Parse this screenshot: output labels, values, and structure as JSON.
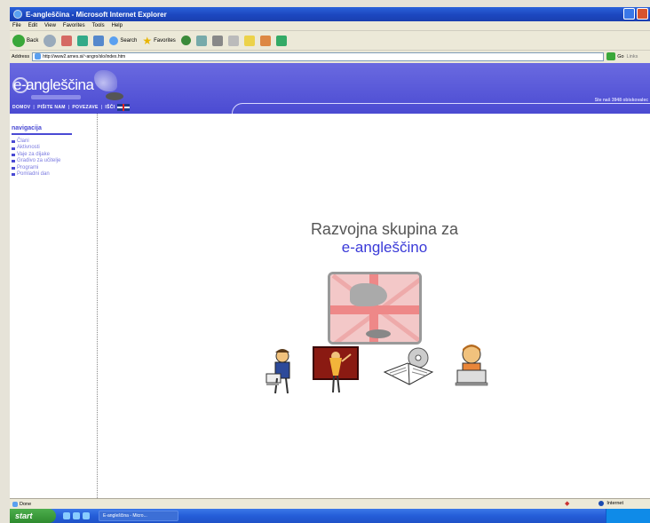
{
  "window": {
    "title": "E-angleščina - Microsoft Internet Explorer"
  },
  "menubar": [
    "File",
    "Edit",
    "View",
    "Favorites",
    "Tools",
    "Help"
  ],
  "toolbar": {
    "back_label": "Back",
    "search_label": "Search",
    "favorites_label": "Favorites"
  },
  "addressbar": {
    "label": "Address",
    "url": "http://www2.arnes.si/~angro/slo/index.htm",
    "go_label": "Go",
    "links_label": "Links"
  },
  "site": {
    "logo": "e-angleščina",
    "nav": [
      "DOMOV",
      "PIŠITE NAM",
      "POVEZAVE",
      "IŠČI"
    ],
    "header_right": "Ste naš 3948 obiskovalec"
  },
  "sidebar": {
    "heading": "navigacija",
    "items": [
      "Člani",
      "Aktivnosti",
      "Vaje za dijake",
      "Gradivo za učitelje",
      "Programi",
      "Pomladni dan"
    ]
  },
  "hero": {
    "line1": "Razvojna skupina za",
    "line2": "e-angleščino"
  },
  "statusbar": {
    "status": "Done",
    "zone": "Internet"
  },
  "taskbar": {
    "start_label": "start",
    "task_item": "E-angleščina - Micro..."
  },
  "colors": {
    "accent": "#4a4ad4",
    "header_bg": "#5858dc",
    "xp_blue": "#245dd8"
  }
}
